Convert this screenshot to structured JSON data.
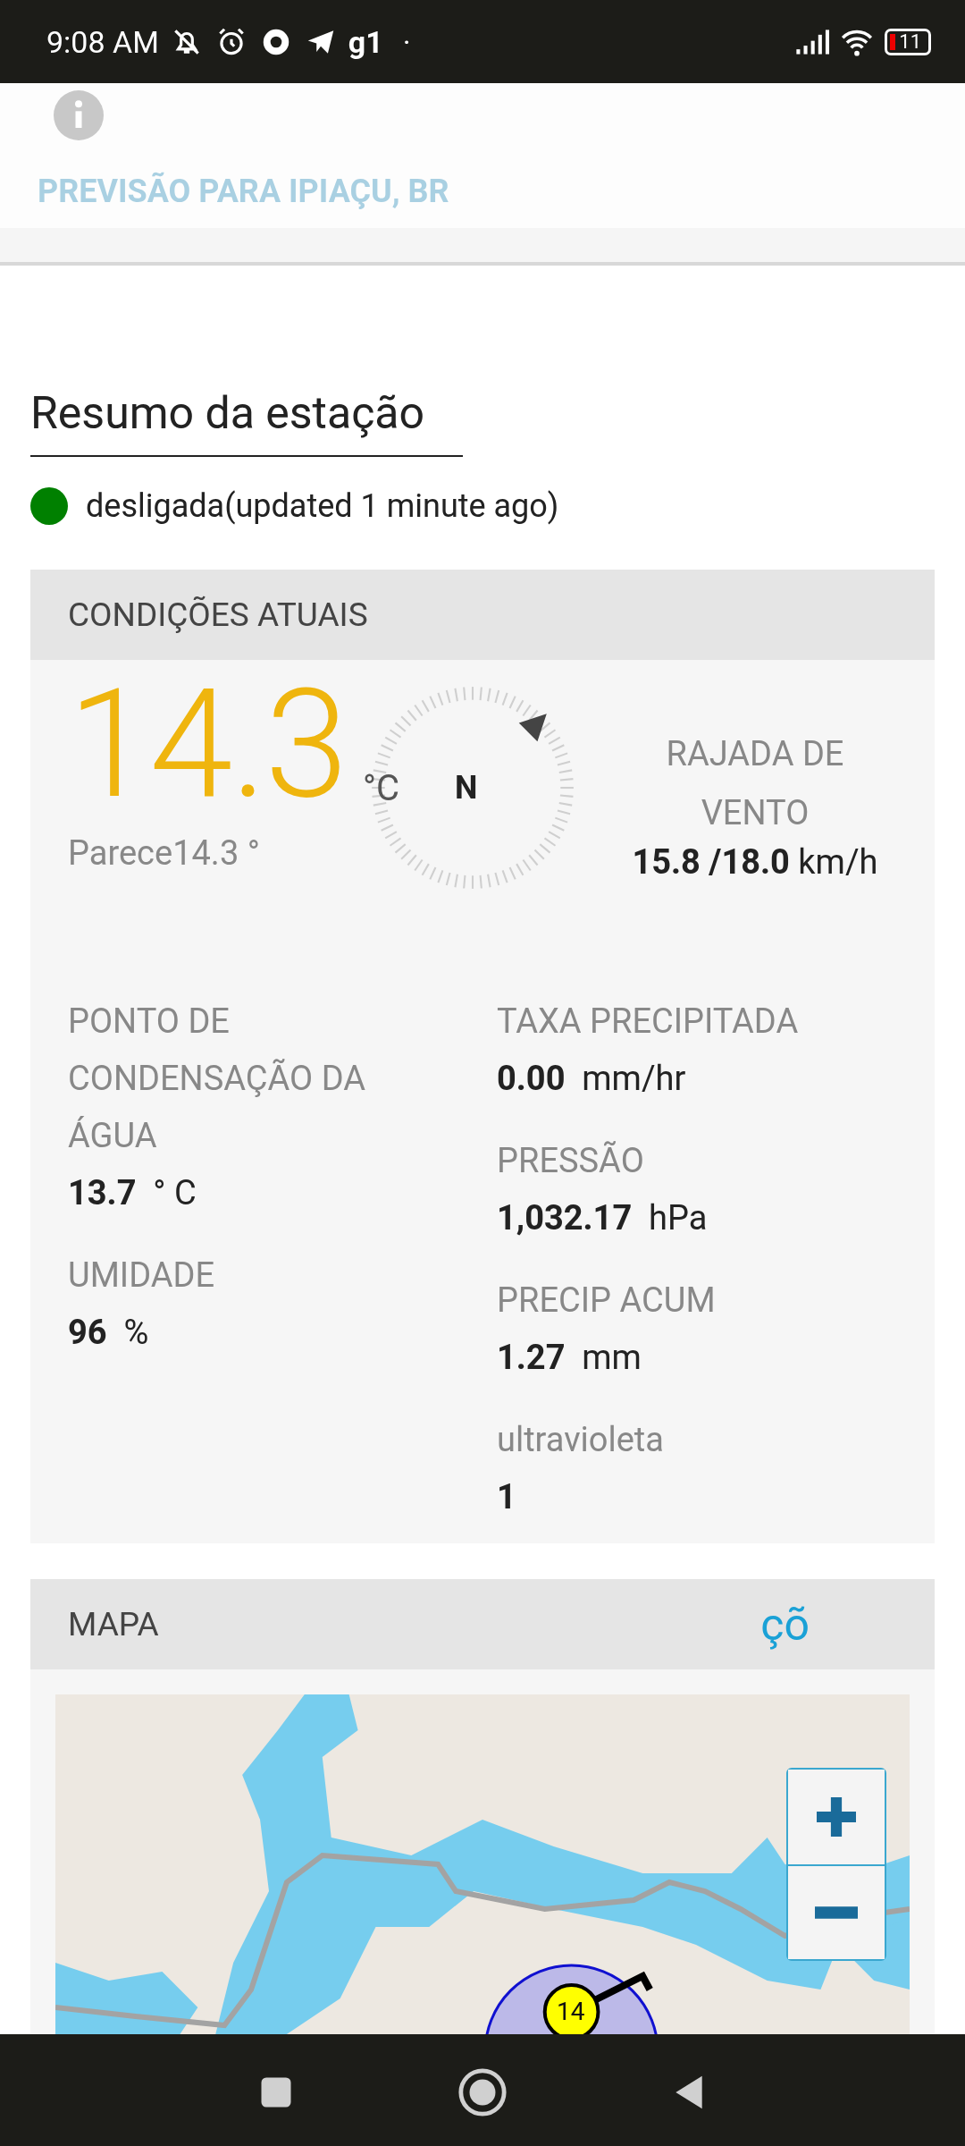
{
  "status_bar": {
    "time": "9:08 AM",
    "app_label": "g1",
    "dot": "·",
    "battery": "11"
  },
  "header": {
    "title": "PREVISÃO PARA IPIAÇU, BR"
  },
  "station": {
    "heading": "Resumo da estação",
    "status": "desligada(updated 1 minute ago)",
    "color": "#008000"
  },
  "current": {
    "heading": "CONDIÇÕES ATUAIS",
    "temperature": "14.3",
    "unit": "°C",
    "compass_label": "N",
    "feels_like": "Parece14.3 °",
    "gust_label": "RAJADA DE VENTO",
    "gust_value": "15.8 /18.0",
    "gust_unit": "km/h",
    "left": [
      {
        "label": "PONTO DE CONDENSAÇÃO DA ÁGUA",
        "value": "13.7",
        "unit": "° C"
      },
      {
        "label": "UMIDADE",
        "value": "96",
        "unit": "%"
      }
    ],
    "right": [
      {
        "label": "TAXA PRECIPITADA",
        "value": "0.00",
        "unit": "mm/hr"
      },
      {
        "label": "PRESSÃO",
        "value": "1,032.17",
        "unit": "hPa"
      },
      {
        "label": "PRECIP ACUM",
        "value": "1.27",
        "unit": "mm"
      },
      {
        "label": "ultravioleta",
        "value": "1"
      }
    ]
  },
  "map": {
    "heading": "MAPA",
    "link": "çõ",
    "marker": "14"
  }
}
